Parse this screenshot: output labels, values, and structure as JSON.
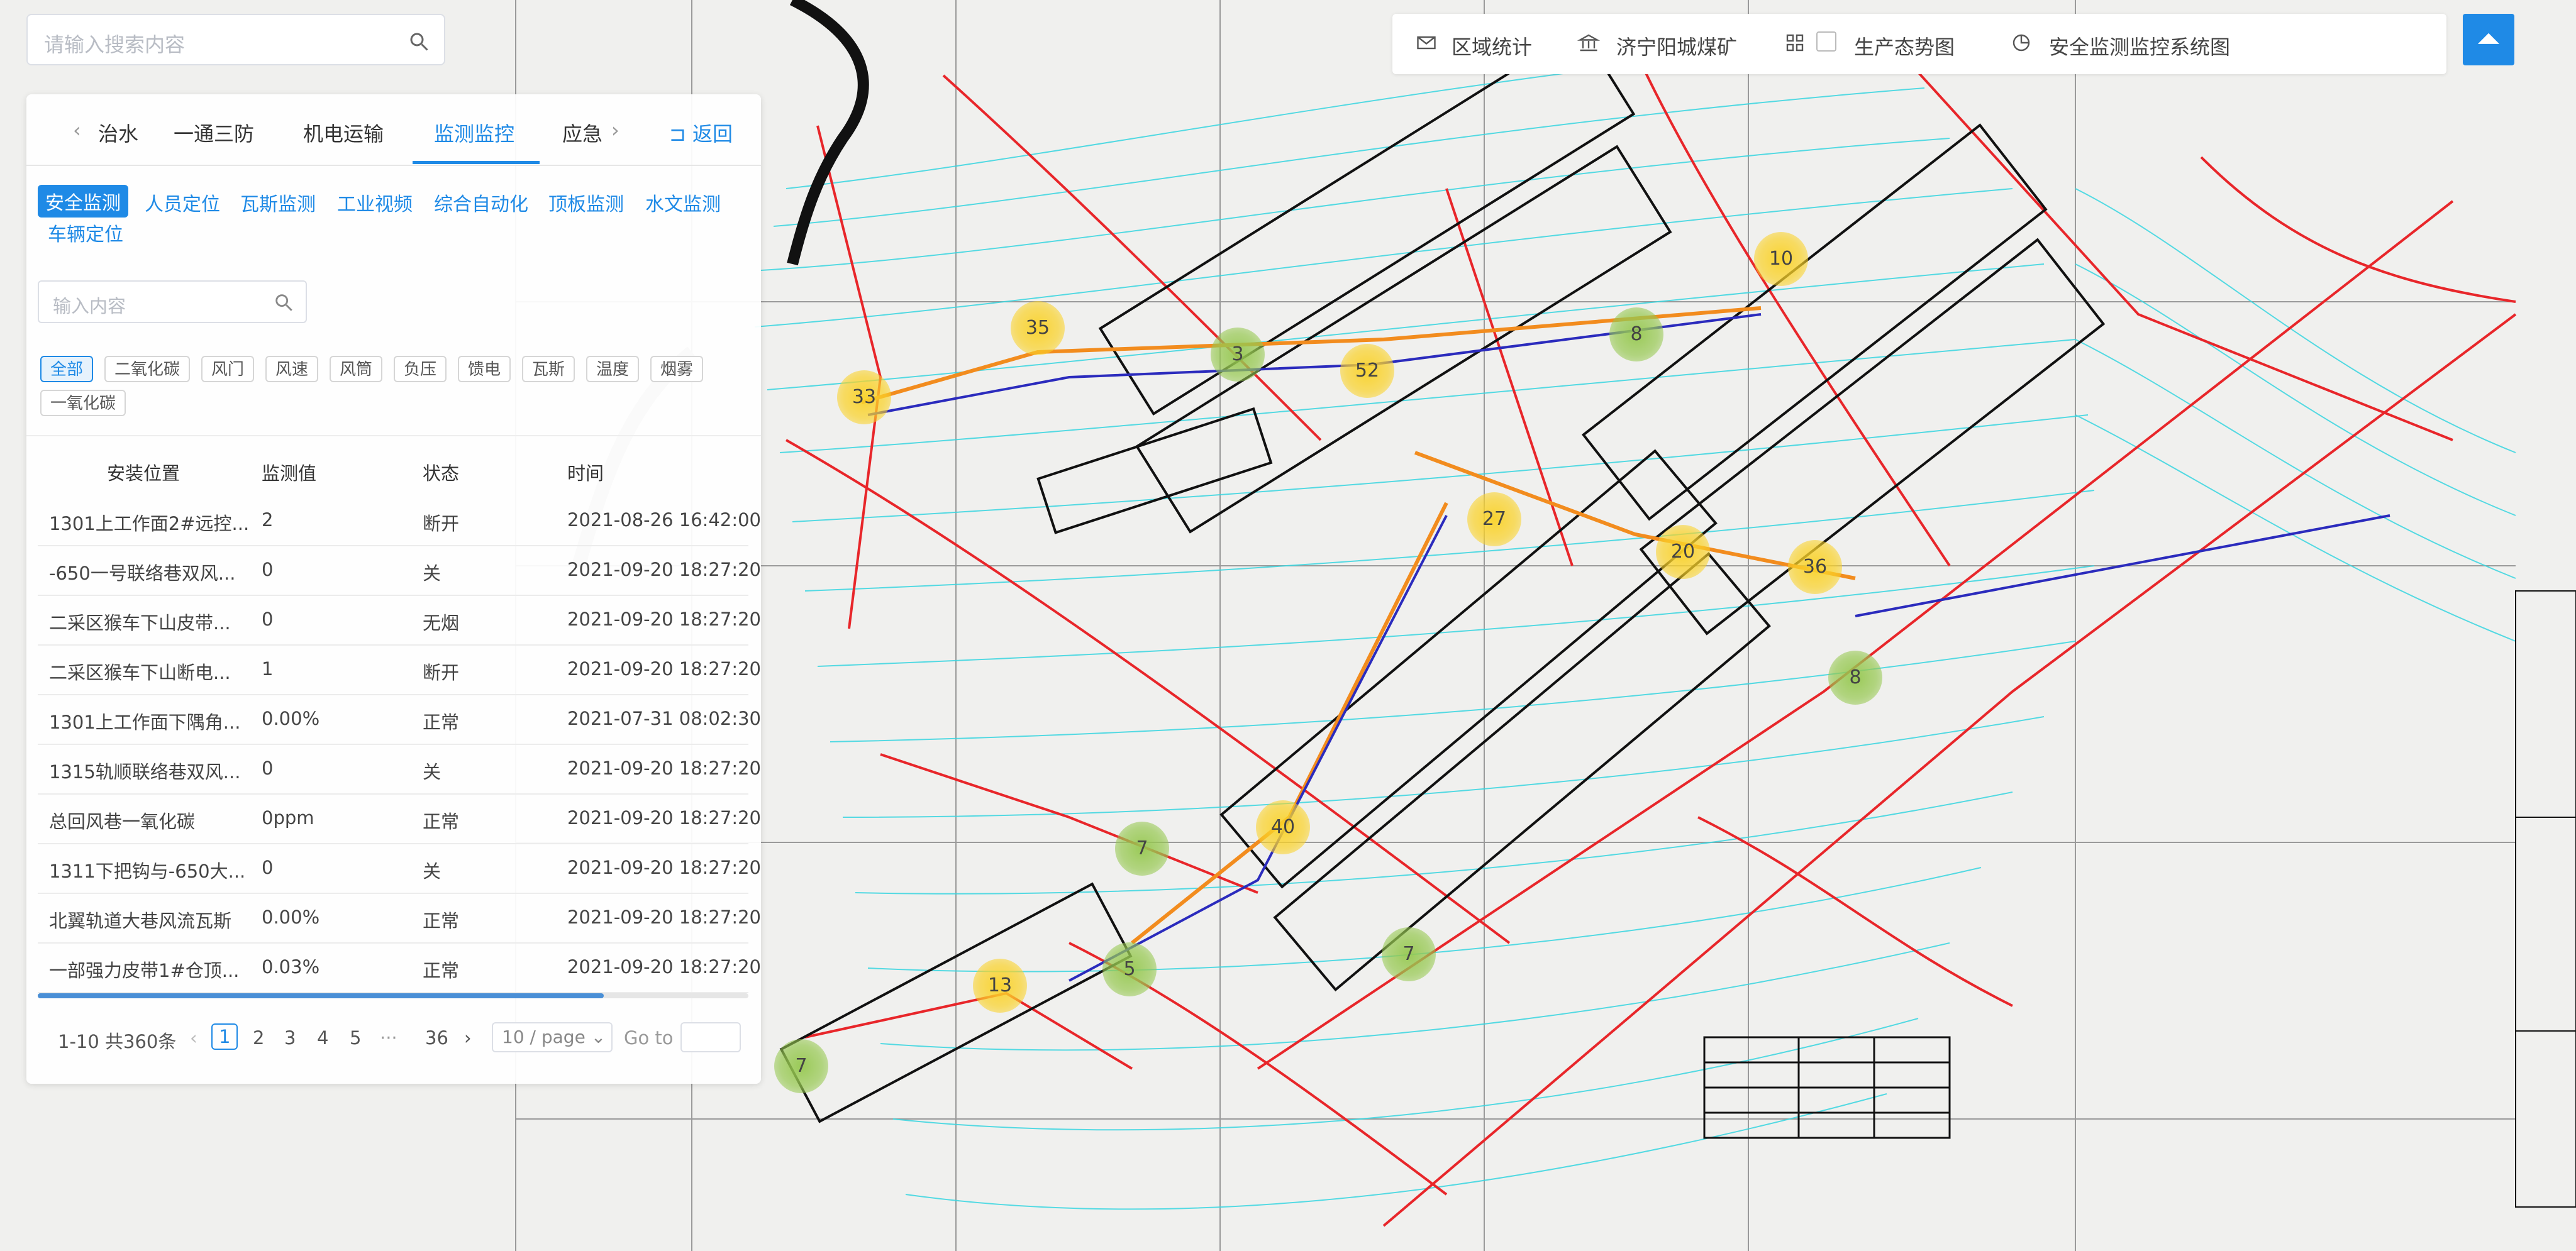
{
  "search": {
    "placeholder": "请输入搜索内容"
  },
  "tabs": [
    {
      "label": "治水"
    },
    {
      "label": "一通三防"
    },
    {
      "label": "机电运输"
    },
    {
      "label": "监测监控"
    },
    {
      "label": "应急"
    }
  ],
  "back_label": "返回",
  "subtabs": [
    "安全监测",
    "人员定位",
    "瓦斯监测",
    "工业视频",
    "综合自动化",
    "顶板监测",
    "水文监测",
    "车辆定位"
  ],
  "filter": {
    "placeholder": "输入内容"
  },
  "chips": [
    "全部",
    "二氧化碳",
    "风门",
    "风速",
    "风筒",
    "负压",
    "馈电",
    "瓦斯",
    "温度",
    "烟雾",
    "一氧化碳"
  ],
  "table": {
    "headers": [
      "安装位置",
      "监测值",
      "状态",
      "时间"
    ],
    "rows": [
      [
        "1301上工作面2#远控...",
        "2",
        "断开",
        "2021-08-26 16:42:00"
      ],
      [
        "-650一号联络巷双风...",
        "0",
        "关",
        "2021-09-20 18:27:20"
      ],
      [
        "二采区猴车下山皮带...",
        "0",
        "无烟",
        "2021-09-20 18:27:20"
      ],
      [
        "二采区猴车下山断电...",
        "1",
        "断开",
        "2021-09-20 18:27:20"
      ],
      [
        "1301上工作面下隅角...",
        "0.00%",
        "正常",
        "2021-07-31 08:02:30"
      ],
      [
        "1315轨顺联络巷双风...",
        "0",
        "关",
        "2021-09-20 18:27:20"
      ],
      [
        "总回风巷一氧化碳",
        "0ppm",
        "正常",
        "2021-09-20 18:27:20"
      ],
      [
        "1311下把钩与-650大...",
        "0",
        "关",
        "2021-09-20 18:27:20"
      ],
      [
        "北翼轨道大巷风流瓦斯",
        "0.00%",
        "正常",
        "2021-09-20 18:27:20"
      ],
      [
        "一部强力皮带1#仓顶...",
        "0.03%",
        "正常",
        "2021-09-20 18:27:20"
      ]
    ]
  },
  "pagination": {
    "total": "1-10 共360条",
    "pages": [
      "1",
      "2",
      "3",
      "4",
      "5"
    ],
    "ellipsis": "···",
    "last": "36",
    "page_size": "10 / page",
    "goto": "Go to"
  },
  "topbar": {
    "items": [
      "区域统计",
      "济宁阳城煤矿",
      "生产态势图",
      "安全监测监控系统图"
    ]
  },
  "clusters": [
    {
      "v": "35",
      "c": "y"
    },
    {
      "v": "33",
      "c": "y"
    },
    {
      "v": "3",
      "c": "g"
    },
    {
      "v": "52",
      "c": "y"
    },
    {
      "v": "10",
      "c": "y"
    },
    {
      "v": "8",
      "c": "g"
    },
    {
      "v": "27",
      "c": "y"
    },
    {
      "v": "20",
      "c": "y"
    },
    {
      "v": "36",
      "c": "y"
    },
    {
      "v": "8",
      "c": "g"
    },
    {
      "v": "40",
      "c": "y"
    },
    {
      "v": "7",
      "c": "g"
    },
    {
      "v": "7",
      "c": "g"
    },
    {
      "v": "5",
      "c": "g"
    },
    {
      "v": "13",
      "c": "y"
    },
    {
      "v": "7",
      "c": "g"
    }
  ],
  "colors": {
    "accent": "#1f8ae6",
    "contour": "#38d6e0",
    "fault": "#e8262a"
  }
}
